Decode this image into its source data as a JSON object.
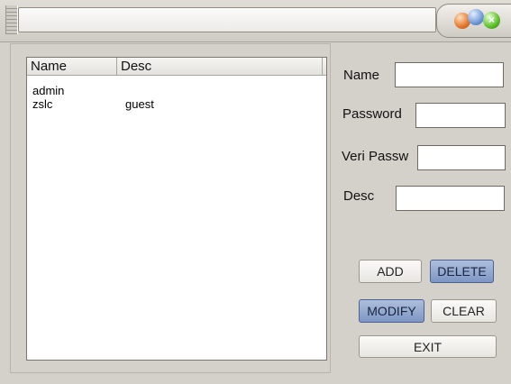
{
  "window": {
    "title": "",
    "controls": {
      "close_glyph": "×"
    }
  },
  "list": {
    "columns": [
      {
        "label": "Name"
      },
      {
        "label": "Desc"
      }
    ],
    "rows": [
      {
        "name": "admin",
        "desc": ""
      },
      {
        "name": "zslc",
        "desc": "guest"
      }
    ]
  },
  "form": {
    "name_label": "Name",
    "name_value": "",
    "password_label": "Password",
    "password_value": "",
    "verify_label": "Veri Passw",
    "verify_value": "",
    "desc_label": "Desc",
    "desc_value": ""
  },
  "buttons": {
    "add": "ADD",
    "delete": "DELETE",
    "modify": "MODIFY",
    "clear": "CLEAR",
    "exit": "EXIT"
  },
  "colors": {
    "active_button": "#8fa4cd",
    "orb_minimize": "#e4762a",
    "orb_maximize": "#6e9ad8",
    "orb_close": "#5cbf2a"
  },
  "icons": [
    "minimize-icon",
    "maximize-icon",
    "close-icon",
    "window-grip-icon"
  ]
}
